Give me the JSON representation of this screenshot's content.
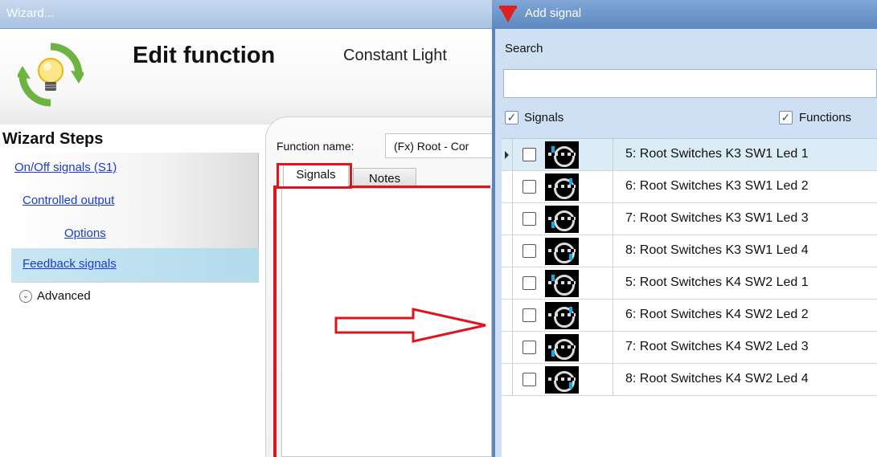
{
  "wizard": {
    "window_title": "Wizard...",
    "heading": "Edit function",
    "function_type": "Constant Light",
    "logo_icon": "light-bulb-cycle-icon",
    "steps_heading": "Wizard Steps",
    "steps": [
      {
        "label": "On/Off signals (S1)"
      },
      {
        "label": "Controlled output"
      },
      {
        "label": "Options"
      },
      {
        "label": "Feedback signals",
        "selected": true
      }
    ],
    "advanced_label": "Advanced",
    "function_name_label": "Function name:",
    "function_name_value": "(Fx) Root - Cor",
    "tabs": [
      {
        "label": "Signals",
        "active": true
      },
      {
        "label": "Notes",
        "active": false
      }
    ]
  },
  "add_signal": {
    "window_title": "Add signal",
    "search_label": "Search",
    "search_value": "",
    "filter_signals_label": "Signals",
    "filter_signals_checked": true,
    "filter_functions_label": "Functions",
    "filter_functions_checked": true,
    "signals": [
      {
        "name": "5: Root Switches K3 SW1 Led 1",
        "checked": false,
        "current": true,
        "led": "top-left"
      },
      {
        "name": "6: Root Switches K3 SW1 Led 2",
        "checked": false,
        "current": false,
        "led": "top-right"
      },
      {
        "name": "7: Root Switches K3 SW1 Led 3",
        "checked": false,
        "current": false,
        "led": "bottom-left"
      },
      {
        "name": "8: Root Switches K3 SW1 Led 4",
        "checked": false,
        "current": false,
        "led": "bottom-right"
      },
      {
        "name": "5: Root Switches K4 SW2 Led 1",
        "checked": false,
        "current": false,
        "led": "top-left"
      },
      {
        "name": "6: Root Switches K4 SW2 Led 2",
        "checked": false,
        "current": false,
        "led": "top-right"
      },
      {
        "name": "7: Root Switches K4 SW2 Led 3",
        "checked": false,
        "current": false,
        "led": "bottom-left"
      },
      {
        "name": "8: Root Switches K4 SW2 Led 4",
        "checked": false,
        "current": false,
        "led": "bottom-right"
      }
    ]
  },
  "colors": {
    "link": "#1a3bd1",
    "annotation": "#e0141d",
    "selected_row": "#dcecf6",
    "led": "#19a7e0"
  }
}
